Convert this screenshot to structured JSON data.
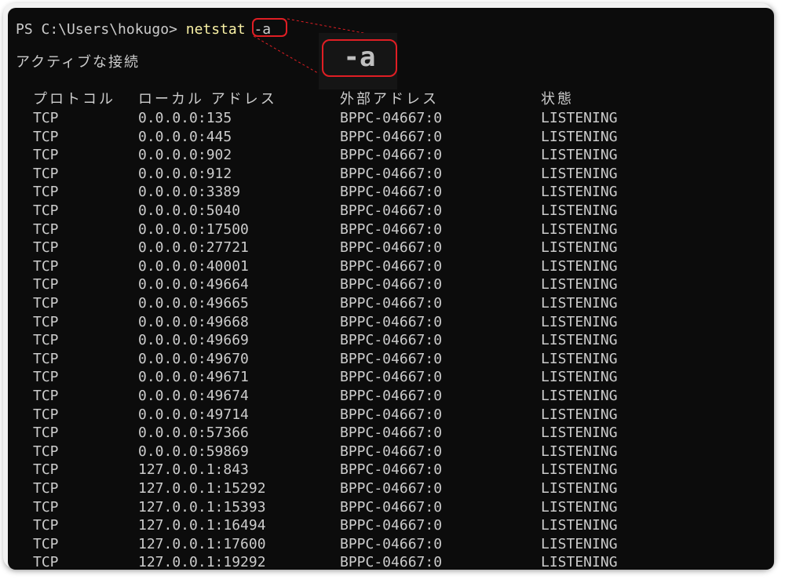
{
  "terminal": {
    "prompt": "PS C:\\Users\\hokugo>",
    "command": "netstat",
    "argument": "-a",
    "zoom_label": "-a",
    "section_title": "アクティブな接続"
  },
  "table": {
    "headers": [
      "プロトコル",
      "ローカル アドレス",
      "外部アドレス",
      "状態"
    ],
    "rows": [
      [
        "TCP",
        "0.0.0.0:135",
        "BPPC-04667:0",
        "LISTENING"
      ],
      [
        "TCP",
        "0.0.0.0:445",
        "BPPC-04667:0",
        "LISTENING"
      ],
      [
        "TCP",
        "0.0.0.0:902",
        "BPPC-04667:0",
        "LISTENING"
      ],
      [
        "TCP",
        "0.0.0.0:912",
        "BPPC-04667:0",
        "LISTENING"
      ],
      [
        "TCP",
        "0.0.0.0:3389",
        "BPPC-04667:0",
        "LISTENING"
      ],
      [
        "TCP",
        "0.0.0.0:5040",
        "BPPC-04667:0",
        "LISTENING"
      ],
      [
        "TCP",
        "0.0.0.0:17500",
        "BPPC-04667:0",
        "LISTENING"
      ],
      [
        "TCP",
        "0.0.0.0:27721",
        "BPPC-04667:0",
        "LISTENING"
      ],
      [
        "TCP",
        "0.0.0.0:40001",
        "BPPC-04667:0",
        "LISTENING"
      ],
      [
        "TCP",
        "0.0.0.0:49664",
        "BPPC-04667:0",
        "LISTENING"
      ],
      [
        "TCP",
        "0.0.0.0:49665",
        "BPPC-04667:0",
        "LISTENING"
      ],
      [
        "TCP",
        "0.0.0.0:49668",
        "BPPC-04667:0",
        "LISTENING"
      ],
      [
        "TCP",
        "0.0.0.0:49669",
        "BPPC-04667:0",
        "LISTENING"
      ],
      [
        "TCP",
        "0.0.0.0:49670",
        "BPPC-04667:0",
        "LISTENING"
      ],
      [
        "TCP",
        "0.0.0.0:49671",
        "BPPC-04667:0",
        "LISTENING"
      ],
      [
        "TCP",
        "0.0.0.0:49674",
        "BPPC-04667:0",
        "LISTENING"
      ],
      [
        "TCP",
        "0.0.0.0:49714",
        "BPPC-04667:0",
        "LISTENING"
      ],
      [
        "TCP",
        "0.0.0.0:57366",
        "BPPC-04667:0",
        "LISTENING"
      ],
      [
        "TCP",
        "0.0.0.0:59869",
        "BPPC-04667:0",
        "LISTENING"
      ],
      [
        "TCP",
        "127.0.0.1:843",
        "BPPC-04667:0",
        "LISTENING"
      ],
      [
        "TCP",
        "127.0.0.1:15292",
        "BPPC-04667:0",
        "LISTENING"
      ],
      [
        "TCP",
        "127.0.0.1:15393",
        "BPPC-04667:0",
        "LISTENING"
      ],
      [
        "TCP",
        "127.0.0.1:16494",
        "BPPC-04667:0",
        "LISTENING"
      ],
      [
        "TCP",
        "127.0.0.1:17600",
        "BPPC-04667:0",
        "LISTENING"
      ],
      [
        "TCP",
        "127.0.0.1:19292",
        "BPPC-04667:0",
        "LISTENING"
      ]
    ]
  },
  "colors": {
    "background": "#0c0c0c",
    "text": "#cccccc",
    "command": "#f9f1a5",
    "highlight": "#e01e24"
  }
}
